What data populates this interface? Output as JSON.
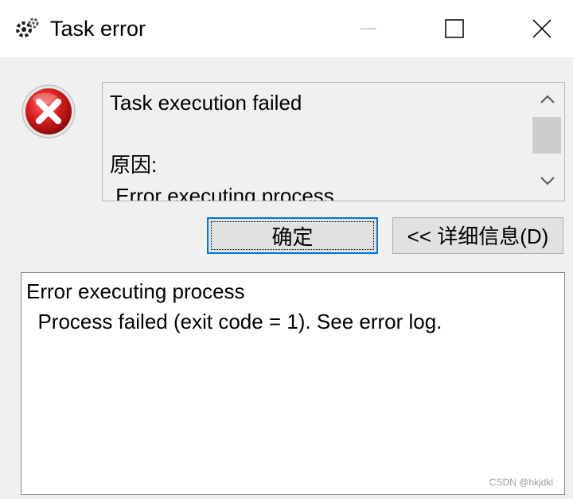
{
  "window": {
    "title": "Task error",
    "icon": "app-gears-icon",
    "controls": [
      "minimize-icon",
      "maximize-icon",
      "close-icon"
    ]
  },
  "message": {
    "icon": "error-icon",
    "line1": "Task execution failed",
    "line2": "",
    "line3": "原因:",
    "line4": " Error executing process"
  },
  "buttons": {
    "ok_label": "确定",
    "details_label": "<< 详细信息(D)"
  },
  "details": {
    "line1": "Error executing process",
    "line2": "  Process failed (exit code = 1). See error log."
  },
  "watermark": "CSDN @hkjdkl",
  "colors": {
    "focus_border": "#0078d7",
    "error_red": "#c8102e",
    "window_bg": "#f0f0f0"
  }
}
